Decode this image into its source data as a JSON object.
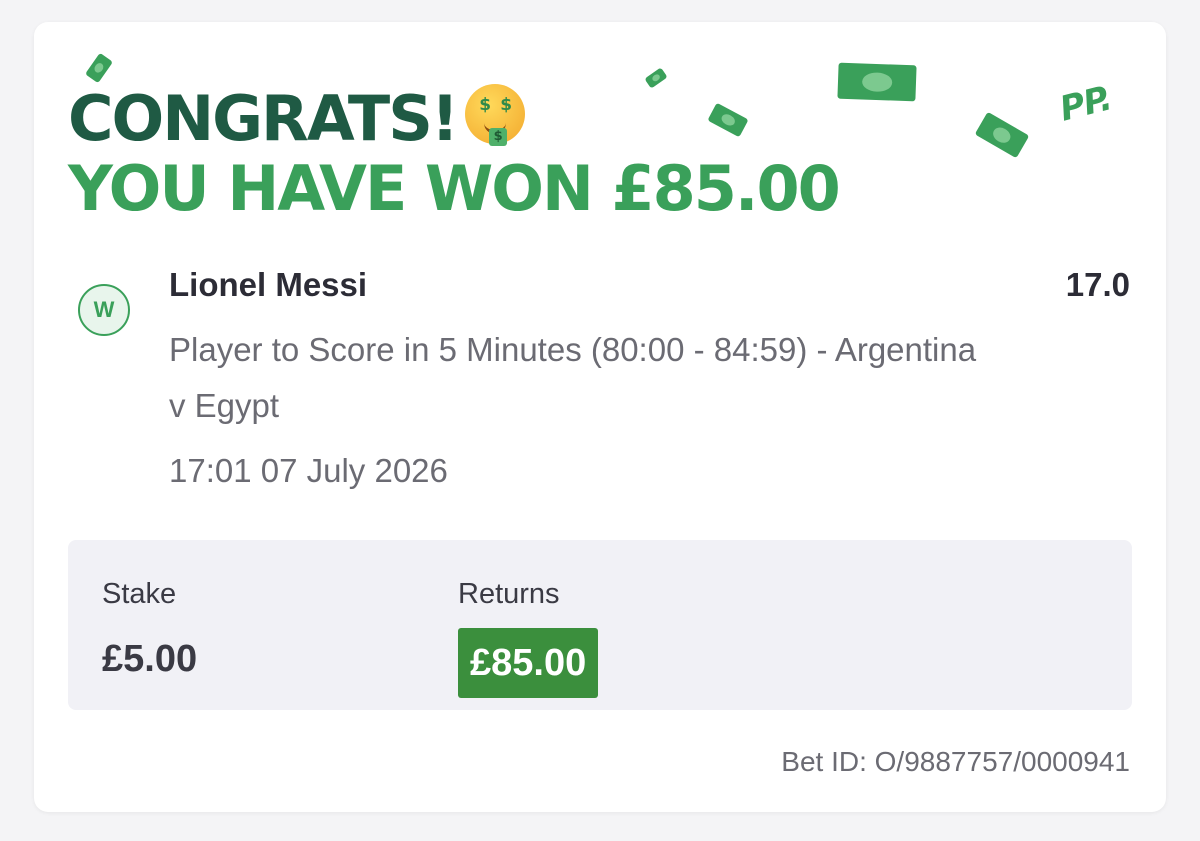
{
  "header": {
    "line1": "CONGRATS!",
    "line2": "YOU HAVE WON £85.00",
    "emoji_icon": "money-mouth-face-icon",
    "emoji_eye": "$",
    "logo_text": "PP."
  },
  "bet": {
    "result_badge": "W",
    "selection": "Lionel Messi",
    "odds": "17.0",
    "market": "Player to Score in 5 Minutes (80:00 - 84:59) - Argentina v Egypt",
    "datetime": "17:01 07 July 2026"
  },
  "summary": {
    "stake_label": "Stake",
    "stake_value": "£5.00",
    "returns_label": "Returns",
    "returns_value": "£85.00"
  },
  "footer": {
    "bet_id": "Bet ID: O/9887757/0000941"
  },
  "colors": {
    "brand_dark_green": "#1f5a44",
    "brand_green": "#3aa05a",
    "returns_green": "#3b8f3d",
    "text_dark": "#2c2c36",
    "text_muted": "#6b6b73",
    "summary_bg": "#f1f1f6"
  }
}
